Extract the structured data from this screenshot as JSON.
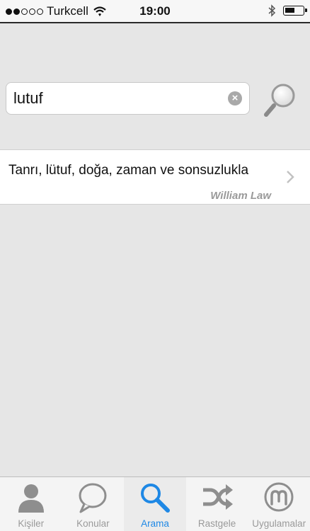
{
  "status_bar": {
    "carrier": "Turkcell",
    "time": "19:00",
    "signal_bars": 2,
    "battery_level": 0.6
  },
  "search": {
    "value": "lutuf",
    "placeholder": ""
  },
  "results": [
    {
      "title": "Tanrı, lütuf, doğa, zaman ve sonsuzlukla",
      "author": "William Law"
    }
  ],
  "tabs": [
    {
      "label": "Kişiler",
      "icon": "person-icon"
    },
    {
      "label": "Konular",
      "icon": "speech-bubble-icon"
    },
    {
      "label": "Arama",
      "icon": "search-icon",
      "active": true
    },
    {
      "label": "Rastgele",
      "icon": "shuffle-icon"
    },
    {
      "label": "Uygulamalar",
      "icon": "apps-logo-icon"
    }
  ],
  "colors": {
    "active_tab": "#1e88e5",
    "inactive_tab": "#9a9a9a",
    "background": "#e6e6e6"
  }
}
